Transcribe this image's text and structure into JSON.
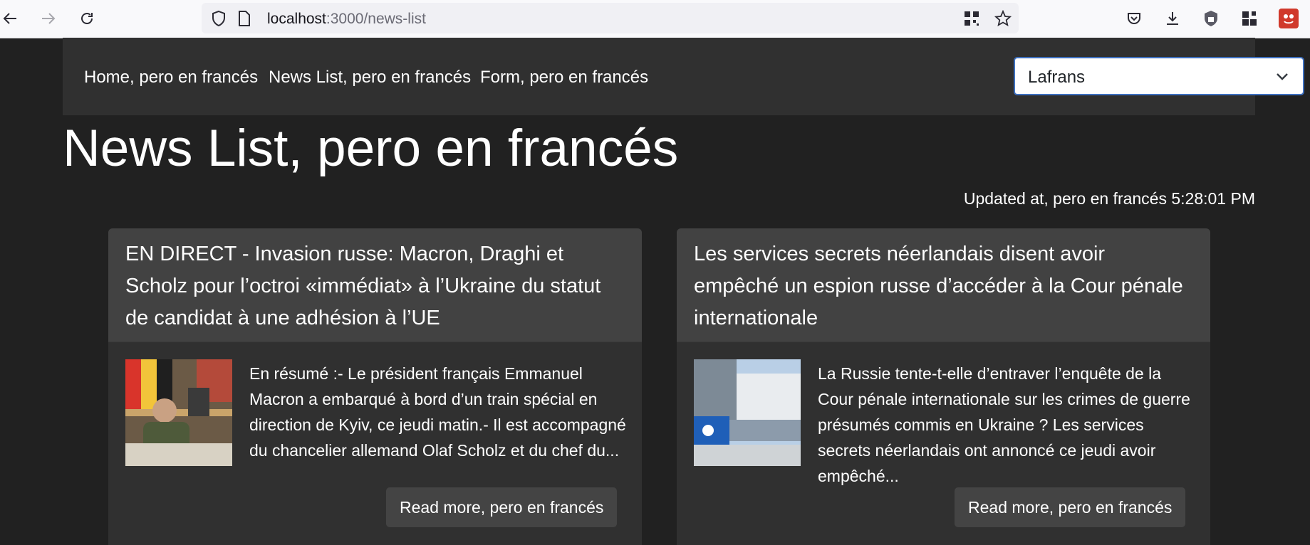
{
  "browser": {
    "url_host": "localhost",
    "url_path": ":3000/news-list"
  },
  "nav": {
    "links": [
      "Home, pero en francés",
      "News List, pero en francés",
      "Form, pero en francés"
    ],
    "language_selected": "Lafrans"
  },
  "page": {
    "title": "News List, pero en francés",
    "updated_label": "Updated at, pero en francés 5:28:01 PM"
  },
  "cards": [
    {
      "title": "EN DIRECT - Invasion russe: Macron, Draghi et Scholz pour l’octroi «immédiat» à l’Ukraine du statut de candidat à une adhésion à l’UE",
      "summary": "En résumé :- Le président français Emmanuel Macron a embarqué à bord d’un train spécial en direction de Kyiv, ce jeudi matin.- Il est accompagné du chancelier allemand Olaf Scholz et du chef du...",
      "button": "Read more, pero en francés"
    },
    {
      "title": "Les services secrets néerlandais disent avoir empêché un espion russe d’accéder à la Cour pénale internationale",
      "summary": "La Russie tente-t-elle d’entraver l’enquête de la Cour pénale internationale sur les crimes de guerre présumés commis en Ukraine ? Les services secrets néerlandais ont annoncé ce jeudi avoir empêché...",
      "button": "Read more, pero en francés"
    }
  ]
}
